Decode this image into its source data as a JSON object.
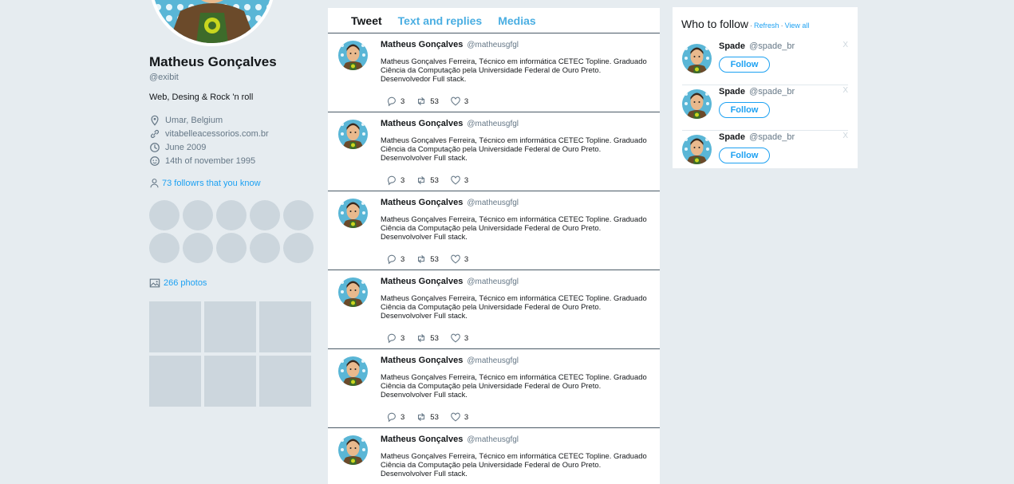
{
  "profile": {
    "name": "Matheus Gonçalves",
    "handle": "@exibit",
    "bio": "Web, Desing & Rock 'n roll",
    "location": "Umar, Belgium",
    "website": "vitabelleacessorios.com.br",
    "joined": "June 2009",
    "birthday": "14th of november 1995",
    "followers_you_know": "73 followrs that you know",
    "photos_count": "266 photos"
  },
  "timeline": {
    "tabs": [
      {
        "label": "Tweet",
        "active": true
      },
      {
        "label": "Text and replies",
        "active": false
      },
      {
        "label": "Medias",
        "active": false
      }
    ],
    "tweets": [
      {
        "name": "Matheus Gonçalves",
        "handle": "@matheusgfgl",
        "text": "Matheus Gonçalves Ferreira, Técnico em informática CETEC Topline. Graduado Ciência da Computação pela Universidade Federal de Ouro Preto. Desenvolvedor Full stack.",
        "replies": "3",
        "retweets": "53",
        "likes": "3"
      },
      {
        "name": "Matheus Gonçalves",
        "handle": "@matheusgfgl",
        "text": "Matheus Gonçalves Ferreira, Técnico em informática CETEC Topline. Graduado Ciência da Computação pela Universidade Federal de Ouro Preto. Desenvolvolver Full stack.",
        "replies": "3",
        "retweets": "53",
        "likes": "3"
      },
      {
        "name": "Matheus Gonçalves",
        "handle": "@matheusgfgl",
        "text": "Matheus Gonçalves Ferreira, Técnico em informática CETEC Topline. Graduado Ciência da Computação pela Universidade Federal de Ouro Preto. Desenvolvolver Full stack.",
        "replies": "3",
        "retweets": "53",
        "likes": "3"
      },
      {
        "name": "Matheus Gonçalves",
        "handle": "@matheusgfgl",
        "text": "Matheus Gonçalves Ferreira, Técnico em informática CETEC Topline. Graduado Ciência da Computação pela Universidade Federal de Ouro Preto. Desenvolvolver Full stack.",
        "replies": "3",
        "retweets": "53",
        "likes": "3"
      },
      {
        "name": "Matheus Gonçalves",
        "handle": "@matheusgfgl",
        "text": "Matheus Gonçalves Ferreira, Técnico em informática CETEC Topline. Graduado Ciência da Computação pela Universidade Federal de Ouro Preto. Desenvolvolver Full stack.",
        "replies": "3",
        "retweets": "53",
        "likes": "3"
      },
      {
        "name": "Matheus Gonçalves",
        "handle": "@matheusgfgl",
        "text": "Matheus Gonçalves Ferreira, Técnico em informática CETEC Topline. Graduado Ciência da Computação pela Universidade Federal de Ouro Preto. Desenvolvolver Full stack.",
        "replies": "",
        "retweets": "",
        "likes": ""
      }
    ]
  },
  "who_to_follow": {
    "title": "Who to follow",
    "separator": "·",
    "refresh": "Refresh",
    "view_all": "View all",
    "suggestions": [
      {
        "name": "Spade",
        "handle": "@spade_br",
        "button": "Follow",
        "dismiss": "X"
      },
      {
        "name": "Spade",
        "handle": "@spade_br",
        "button": "Follow",
        "dismiss": "X"
      },
      {
        "name": "Spade",
        "handle": "@spade_br",
        "button": "Follow",
        "dismiss": "X"
      }
    ]
  },
  "colors": {
    "background": "#e6ecf0",
    "accent": "#1da1f2",
    "tab_inactive": "#4aaee2",
    "placeholder": "#ccd6dd"
  }
}
